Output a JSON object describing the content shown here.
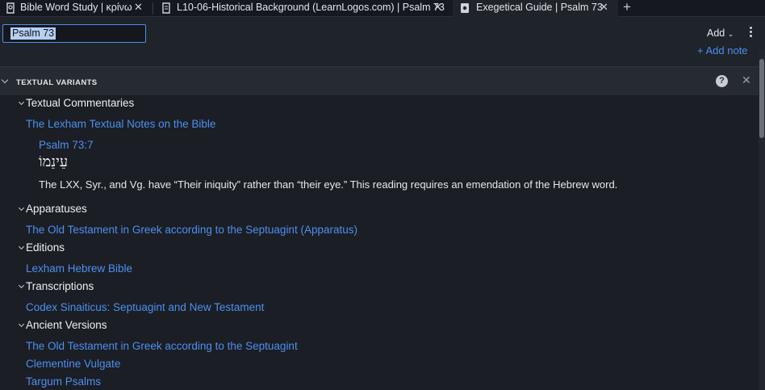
{
  "tabs": [
    {
      "label": "Bible Word Study | κρίνω",
      "icon": "word-study-icon",
      "active": false
    },
    {
      "label": "L10-06-Historical Background (LearnLogos.com) | Psalm 73",
      "icon": "document-icon",
      "active": false
    },
    {
      "label": "Exegetical Guide | Psalm 73",
      "icon": "guide-icon",
      "active": true
    }
  ],
  "toolbar": {
    "reference_value": "Psalm 73",
    "add_label": "Add",
    "more_icon": "kebab-icon"
  },
  "add_note_label": "+ Add note",
  "section": {
    "title": "TEXTUAL VARIANTS",
    "help_label": "?"
  },
  "groups": {
    "textual_commentaries": {
      "label": "Textual Commentaries",
      "links": [
        "The Lexham Textual Notes on the Bible"
      ],
      "entry": {
        "reference": "Psalm 73:7",
        "hebrew": "עֵינֵמוֹ",
        "note": "The LXX, Syr., and Vg. have “Their iniquity” rather than “their eye.” This reading requires an emendation of the Hebrew word."
      }
    },
    "apparatuses": {
      "label": "Apparatuses",
      "links": [
        "The Old Testament in Greek according to the Septuagint (Apparatus)"
      ]
    },
    "editions": {
      "label": "Editions",
      "links": [
        "Lexham Hebrew Bible"
      ]
    },
    "transcriptions": {
      "label": "Transcriptions",
      "links": [
        "Codex Sinaiticus: Septuagint and New Testament"
      ]
    },
    "ancient_versions": {
      "label": "Ancient Versions",
      "links": [
        "The Old Testament in Greek according to the Septuagint",
        "Clementine Vulgate",
        "Targum Psalms"
      ]
    }
  },
  "colors": {
    "accent_link": "#4d8ff0",
    "background": "#1b1e24",
    "tabbar": "#151820"
  }
}
